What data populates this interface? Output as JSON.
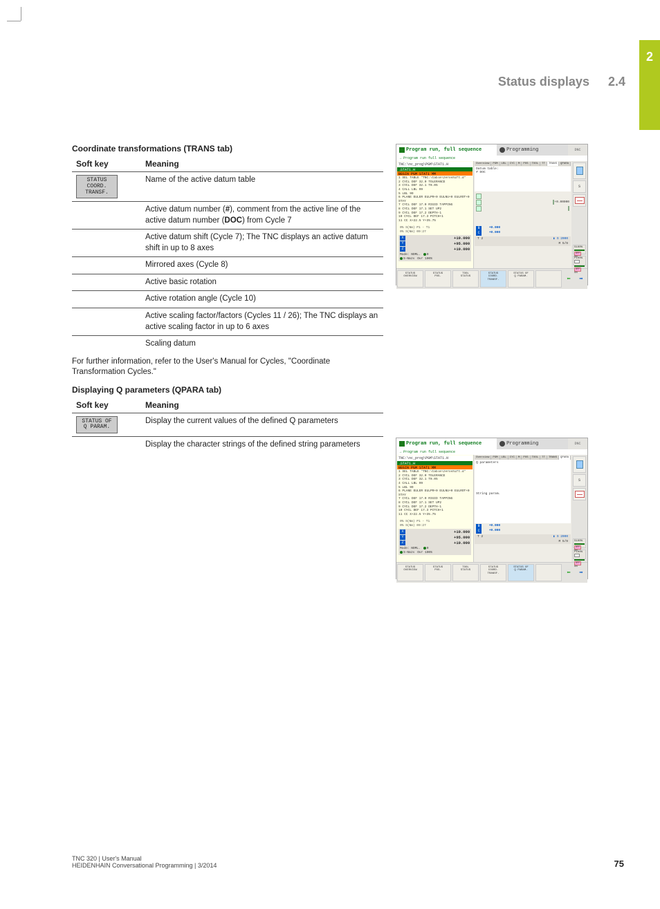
{
  "chapter_tab": "2",
  "header_title": "Status displays",
  "header_num": "2.4",
  "section1": {
    "title": "Coordinate transformations (TRANS tab)",
    "th_softkey": "Soft key",
    "th_meaning": "Meaning",
    "softkey1": "STATUS\nCOORD.\nTRANSF.",
    "rows": [
      "Name of the active datum table",
      "Active datum number (#), comment from the active line of the active datum number (DOC) from Cycle 7",
      "Active datum shift (Cycle 7); The TNC displays an active datum shift in up to 8 axes",
      "Mirrored axes (Cycle 8)",
      "Active basic rotation",
      "Active rotation angle (Cycle 10)",
      "Active scaling factor/factors (Cycles 11 / 26); The TNC displays an active scaling factor in up to 6 axes",
      "Scaling datum"
    ],
    "note": "For further information, refer to the User's Manual for Cycles, \"Coordinate Transformation Cycles.\""
  },
  "section2": {
    "title": "Displaying Q parameters (QPARA tab)",
    "th_softkey": "Soft key",
    "th_meaning": "Meaning",
    "softkey1": "STATUS OF\nQ PARAM.",
    "rows": [
      "Display the current values of the defined Q parameters",
      "Display the character strings of the defined string parameters"
    ]
  },
  "shot_common": {
    "title_left": "Program run, full sequence",
    "subtitle": "Program run full sequence",
    "title_right": "Programming",
    "dnc": "DNC",
    "path": "TNC:\\nc_prog\\PGM\\STAT1.H",
    "strip1": "→STAT1.H",
    "strip2": "   BEGIN PGM STAT1 MM",
    "lines": [
      "1  SEL TABLE \"TNC:\\table\\zeroshift.d\"",
      "2  CYCL DEF 32.0 TOLERANCE",
      "3  CYCL DEF 32.1 T0.05",
      "4  CALL LBL 99",
      "5  LBL 99",
      "6  PLANE EULER EULPR+0 EULNU+0 EULROT+0",
      "   STAY",
      "7  CYCL DEF 17.0 RIGID TAPPING",
      "8  CYCL DEF 17.1 SET UP2",
      "9  CYCL DEF 17.2 DEPTH-1",
      "10 CYCL DEF 17.3 PITCH+1",
      "11 CC  X+22.5  Y+35.75"
    ],
    "pl_bottom1": "0% S(Nm) P1 - T1",
    "pl_bottom2": "0% S(Nm) 09:27",
    "pos": {
      "x_label": "X",
      "x_val": "+10.000",
      "y_label": "Y",
      "y_val": "+95.000",
      "z_label": "Z",
      "z_val": "+10.000",
      "b_label": "B",
      "b_val": "+0.000",
      "c_label": "C",
      "c_val": "+0.000",
      "foot_mode": "Mode: NOML.",
      "foot_ovr": "Ovr 100%",
      "foot_t": "T 2",
      "foot_m": "M 5/9",
      "foot_s": "S 2000",
      "foot_sns": "S-NmJs"
    },
    "tabs": [
      "Overview",
      "PGM",
      "LBL",
      "CYC",
      "M",
      "POS",
      "TOOL",
      "TT",
      "TRANS",
      "QPARA"
    ],
    "mid_trans_hdr": "Datum table:",
    "mid_trans_num": "#     DOC",
    "mid_trans_rot": "+0.00000",
    "mid_qpara_hdr": "Q parameters",
    "mid_qpara_str": "String param.",
    "softkeys": [
      "STATUS\nOVERVIEW",
      "STATUS\nPOS.",
      "TOOL\nSTATUS",
      "STATUS\nCOORD.\nTRANSF.",
      "STATUS OF\nQ PARAM."
    ],
    "right_labels": {
      "s100": "S100%",
      "f100": "F100%",
      "off": "OFF",
      "on": "ON"
    }
  },
  "footer": {
    "line1": "TNC 320 | User's Manual",
    "line2": "HEIDENHAIN Conversational Programming | 3/2014",
    "page": "75"
  }
}
